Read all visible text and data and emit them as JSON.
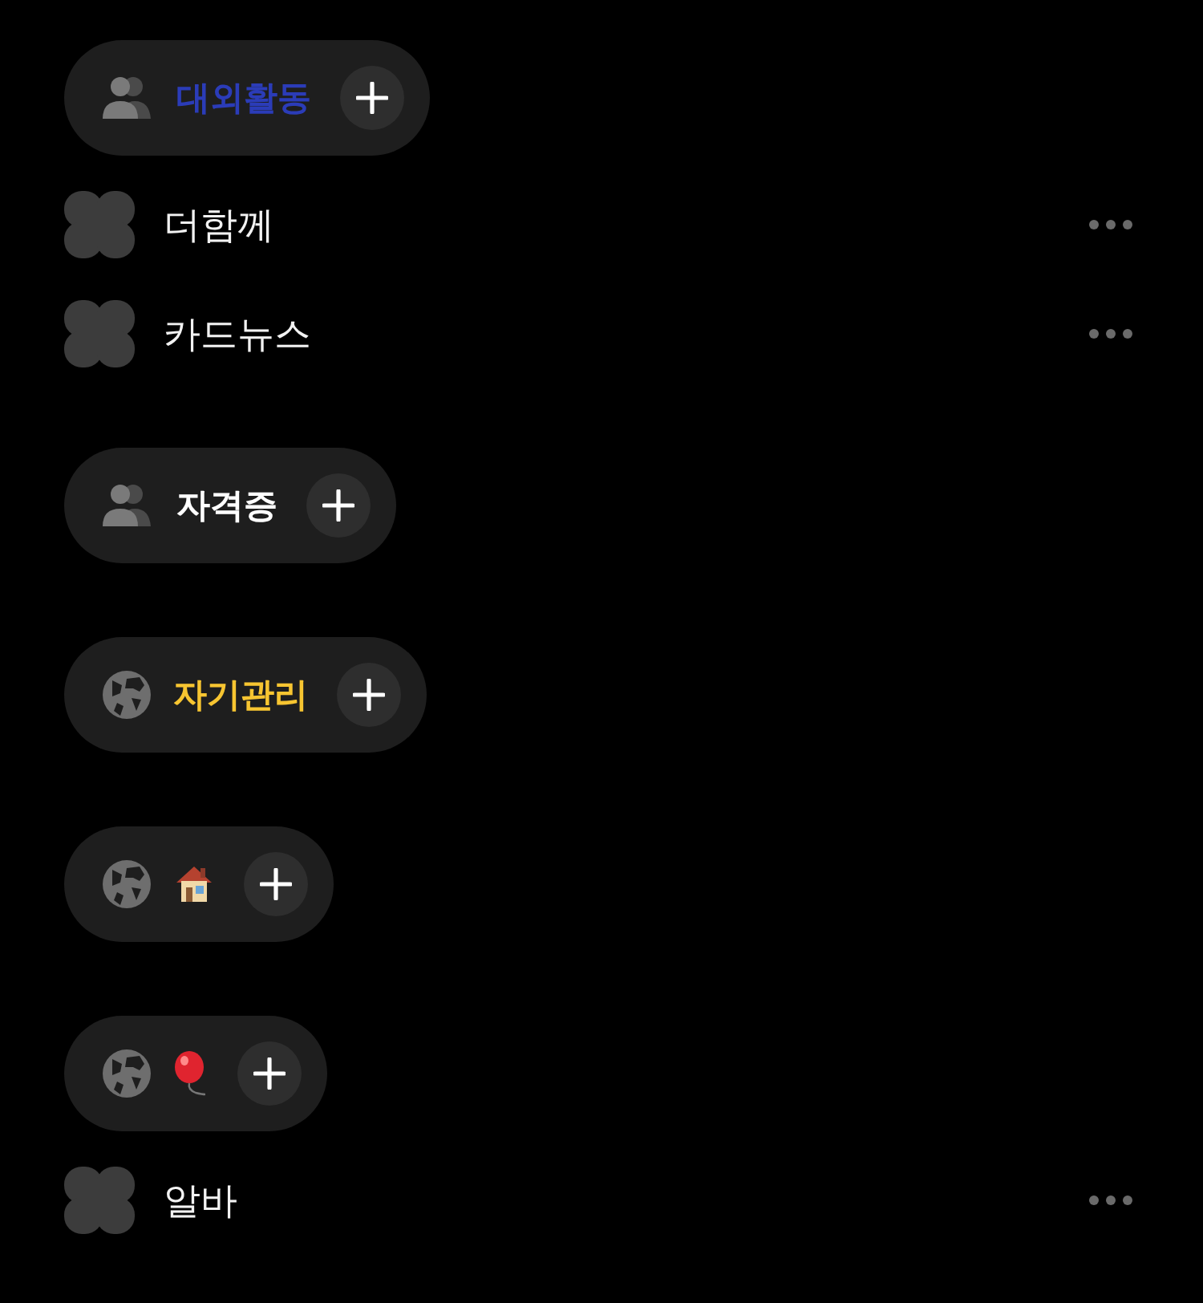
{
  "groups": [
    {
      "kind": "people",
      "title": "대외활동",
      "color": "#2b3cb8",
      "items": [
        {
          "name": "더함께"
        },
        {
          "name": "카드뉴스"
        }
      ]
    },
    {
      "kind": "people",
      "title": "자격증",
      "color": "#ffffff"
    },
    {
      "kind": "globe",
      "title": "자기관리",
      "color": "#f7c531"
    },
    {
      "kind": "globe",
      "emblem": {
        "kind": "house"
      }
    },
    {
      "kind": "globe",
      "emblem": {
        "kind": "balloon"
      },
      "items": [
        {
          "name": "알바"
        }
      ]
    }
  ]
}
